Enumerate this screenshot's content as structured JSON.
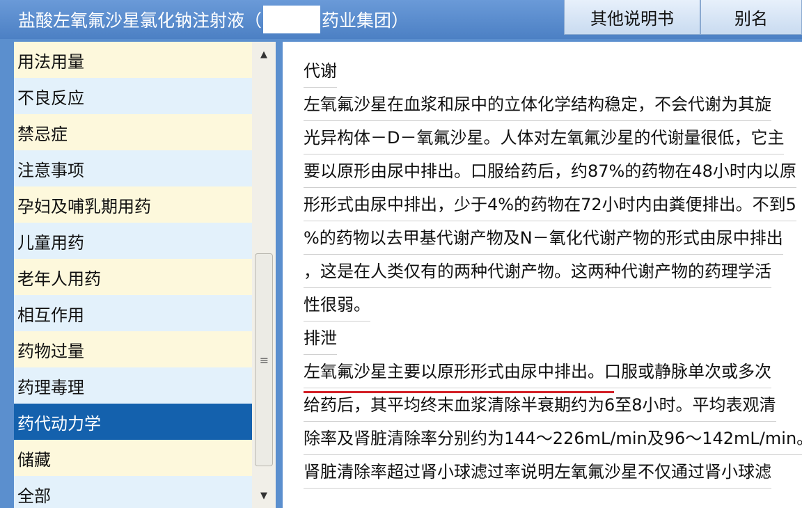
{
  "window": {
    "title_prefix": "盐酸左氧氟沙星氯化钠注射液（",
    "title_suffix": "药业集团）"
  },
  "toolbar": {
    "other_manuals": "其他说明书",
    "alias": "别名"
  },
  "sidebar": {
    "items": [
      {
        "label": "用法用量"
      },
      {
        "label": "不良反应"
      },
      {
        "label": "禁忌症"
      },
      {
        "label": "注意事项"
      },
      {
        "label": "孕妇及哺乳期用药"
      },
      {
        "label": "儿童用药"
      },
      {
        "label": "老年人用药"
      },
      {
        "label": "相互作用"
      },
      {
        "label": "药物过量"
      },
      {
        "label": "药理毒理"
      },
      {
        "label": "药代动力学"
      },
      {
        "label": "储藏"
      },
      {
        "label": "全部"
      }
    ],
    "selected": "药代动力学"
  },
  "content": {
    "lines": [
      "代谢",
      "左氧氟沙星在血浆和尿中的立体化学结构稳定，不会代谢为其旋",
      "光异构体－D－氧氟沙星。人体对左氧氟沙星的代谢量很低，它主",
      "要以原形由尿中排出。口服给药后，约87%的药物在48小时内以原",
      "形形式由尿中排出，少于4%的药物在72小时内由粪便排出。不到5",
      "%的药物以去甲基代谢产物及N－氧化代谢产物的形式由尿中排出",
      "，这是在人类仅有的两种代谢产物。这两种代谢产物的药理学活",
      "性很弱。",
      "排泄",
      "左氧氟沙星主要以原形形式由尿中排出。口服或静脉单次或多次",
      "给药后，其平均终末血浆清除半衰期约为6至8小时。平均表观清",
      "除率及肾脏清除率分别约为144～226mL/min及96～142mL/min。",
      "肾脏清除率超过肾小球滤过率说明左氧氟沙星不仅通过肾小球滤"
    ]
  },
  "colors": {
    "frame": "#5b8fce",
    "selected_item": "#1461ad",
    "highlight_underline": "#d31f26"
  }
}
